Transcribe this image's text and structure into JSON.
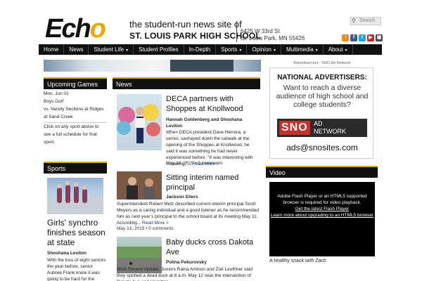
{
  "header": {
    "logo_a": "Ech",
    "logo_b": "o",
    "tagline": "the student-run news site of",
    "school": "ST. LOUIS PARK HIGH SCHOOL",
    "addr1": "6425 W 33rd St",
    "addr2": "St. Louis Park, MN 55426",
    "search_placeholder": "Search",
    "social": [
      {
        "icon": "rss-icon",
        "glyph": "◔",
        "color": "#f08a24"
      },
      {
        "icon": "facebook-icon",
        "glyph": "f",
        "color": "#3b5998"
      },
      {
        "icon": "twitter-icon",
        "glyph": "t",
        "color": "#1da1f2"
      },
      {
        "icon": "youtube-icon",
        "glyph": "▶",
        "color": "#cc2020"
      },
      {
        "icon": "instagram-icon",
        "glyph": "▣",
        "color": "#444444"
      }
    ]
  },
  "nav": [
    {
      "label": "Home",
      "caret": ""
    },
    {
      "label": "News",
      "caret": ""
    },
    {
      "label": "Student Life",
      "caret": "▾"
    },
    {
      "label": "Student Profiles",
      "caret": ""
    },
    {
      "label": "In-Depth",
      "caret": ""
    },
    {
      "label": "Sports",
      "caret": "▾"
    },
    {
      "label": "Opinion",
      "caret": "▾"
    },
    {
      "label": "Multimedia",
      "caret": "▾"
    },
    {
      "label": "About",
      "caret": "▾"
    }
  ],
  "upcoming": {
    "heading": "Upcoming Games",
    "date": "Mon, Jun 01",
    "sport": "Boys Golf",
    "event": "vs. Varsity Sections at Ridges at Sand Creek",
    "note": "Click on any sport above to see a full schedule for that sport."
  },
  "sports": {
    "heading": "Sports",
    "title": "Girls' synchro finishes season at state",
    "author": "Shoshana Leviton",
    "excerpt": "With the loss of eight seniors the year before, senior Aubree Frank knew it was going to be hard for the"
  },
  "news": {
    "heading": "News",
    "stories": [
      {
        "title": "DECA partners with Shoppes at Knollwood",
        "author": "Hannah Goldenberg and Shoshana Leviton",
        "excerpt": "When DECA president Dave Herrera, a senior, sashayed down the catwalk at the opening of the Shoppes at Knollwood, he said it was something he had never experienced before. “It was interesting with modeling,”...",
        "more": "Read More »",
        "date": "May 14, 2015 • 0 comments"
      },
      {
        "title": "Sitting interim named principal",
        "author": "Jackson Eilers",
        "excerpt": "Superintendent Robert Metz described current interim principal Scott Meyers as a caring individual and a good listener as he recommended him as next year’s principal to the school board at its meeting May 11. According...",
        "more": "Read More »",
        "date": "May 13, 2015 • 0 comments"
      },
      {
        "title": "Baby ducks cross Dakota Ave",
        "author": "Polina Pekurovsky",
        "excerpt": "Most Recent Update: Juniors Raina Amtson and Zoë Leuthner said they spotted a dead duck at 8 a.m. May 12 near the intersection of Dakota Ave and Hamilton",
        "more": "",
        "date": ""
      }
    ]
  },
  "ad": {
    "label": "Advertisement - SNO Ad Network",
    "headline": "NATIONAL ADVERTISERS:",
    "text": "Want to reach a diverse audience of high school and college students?",
    "logo": "SNO",
    "logo_right1": "AD",
    "logo_right2": "NETWORK",
    "email": "ads@snosites.com"
  },
  "video": {
    "heading": "Video",
    "line1": "Adobe Flash Player or an HTML5 supported browser is required for video playback.",
    "link1": "Get the latest Flash Player",
    "link2": "Learn more about upgrading to an HTML5 browser",
    "caption": "A healthy snack with Zach"
  }
}
